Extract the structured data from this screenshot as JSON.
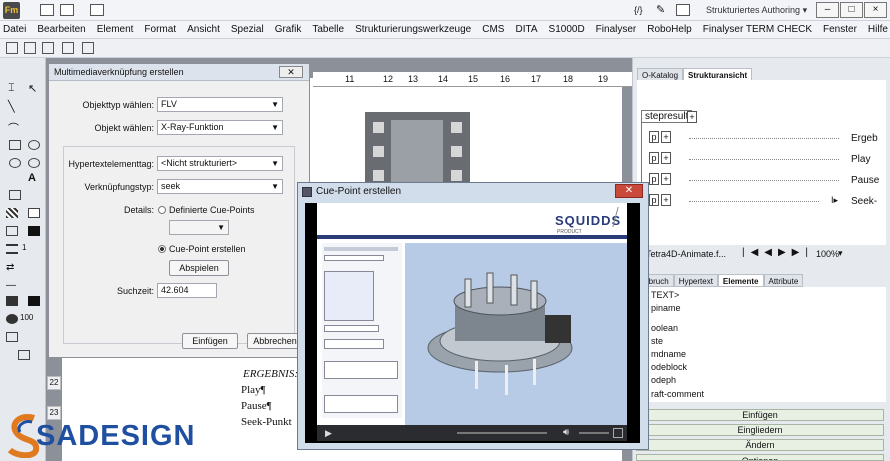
{
  "app": {
    "logo": "Fm",
    "mode": "Strukturiertes Authoring",
    "code_icon": "{/}"
  },
  "menu": [
    "Datei",
    "Bearbeiten",
    "Element",
    "Format",
    "Ansicht",
    "Spezial",
    "Grafik",
    "Tabelle",
    "Strukturierungswerkzeuge",
    "CMS",
    "DITA",
    "S1000D",
    "Finalyser",
    "RoboHelp",
    "Finalyser TERM CHECK",
    "Fenster",
    "Hilfe"
  ],
  "window_controls": {
    "minimize": "–",
    "maximize": "□",
    "close": "×"
  },
  "palette": {
    "row_a": "1",
    "row_b": "100"
  },
  "ruler": [
    "11",
    "12",
    "13",
    "14",
    "15",
    "16",
    "17",
    "18",
    "19"
  ],
  "document": {
    "line_numbers": [
      "22",
      "23"
    ],
    "heading": "ERGEBNIS:",
    "lines": [
      "Play¶",
      "Pause¶",
      "Seek-Punkt"
    ]
  },
  "right_panel": {
    "tabs": [
      "O-Katalog",
      "Strukturansicht"
    ],
    "root_node": "stepresult",
    "plus": "+",
    "p_label": "p",
    "struct_items": [
      "Ergeb",
      "Play",
      "Pause",
      "Seek-"
    ],
    "nav_file": "Tetra4D-Animate.f...",
    "zoom": "100%",
    "lower_tabs": [
      "mbruch",
      "Hypertext",
      "Elemente",
      "Attribute"
    ],
    "elements": [
      "TEXT>",
      "piname",
      "oolean",
      "ste",
      "mdname",
      "odeblock",
      "odeph",
      "raft-comment"
    ],
    "buttons": [
      "Einfügen",
      "Eingliedern",
      "Ändern",
      "Optionen"
    ]
  },
  "dialog_multimedia": {
    "title": "Multimediaverknüpfung erstellen",
    "objtype_label": "Objekttyp wählen:",
    "objtype_value": "FLV",
    "object_label": "Objekt wählen:",
    "object_value": "X-Ray-Funktion",
    "hyper_label": "Hypertextelementtag:",
    "hyper_value": "<Nicht strukturiert>",
    "link_label": "Verknüpfungstyp:",
    "link_value": "seek",
    "details_label": "Details:",
    "radio_defined": "Definierte Cue-Points",
    "radio_create": "Cue-Point erstellen",
    "play_button": "Abspielen",
    "seek_label": "Suchzeit:",
    "seek_value": "42.604",
    "insert_button": "Einfügen",
    "cancel_button": "Abbrechen"
  },
  "dialog_cuepoint": {
    "title": "Cue-Point erstellen",
    "brand": "SQUIDDS",
    "brand_sub": "PRODUCT"
  },
  "watermark": "SADESIGN"
}
